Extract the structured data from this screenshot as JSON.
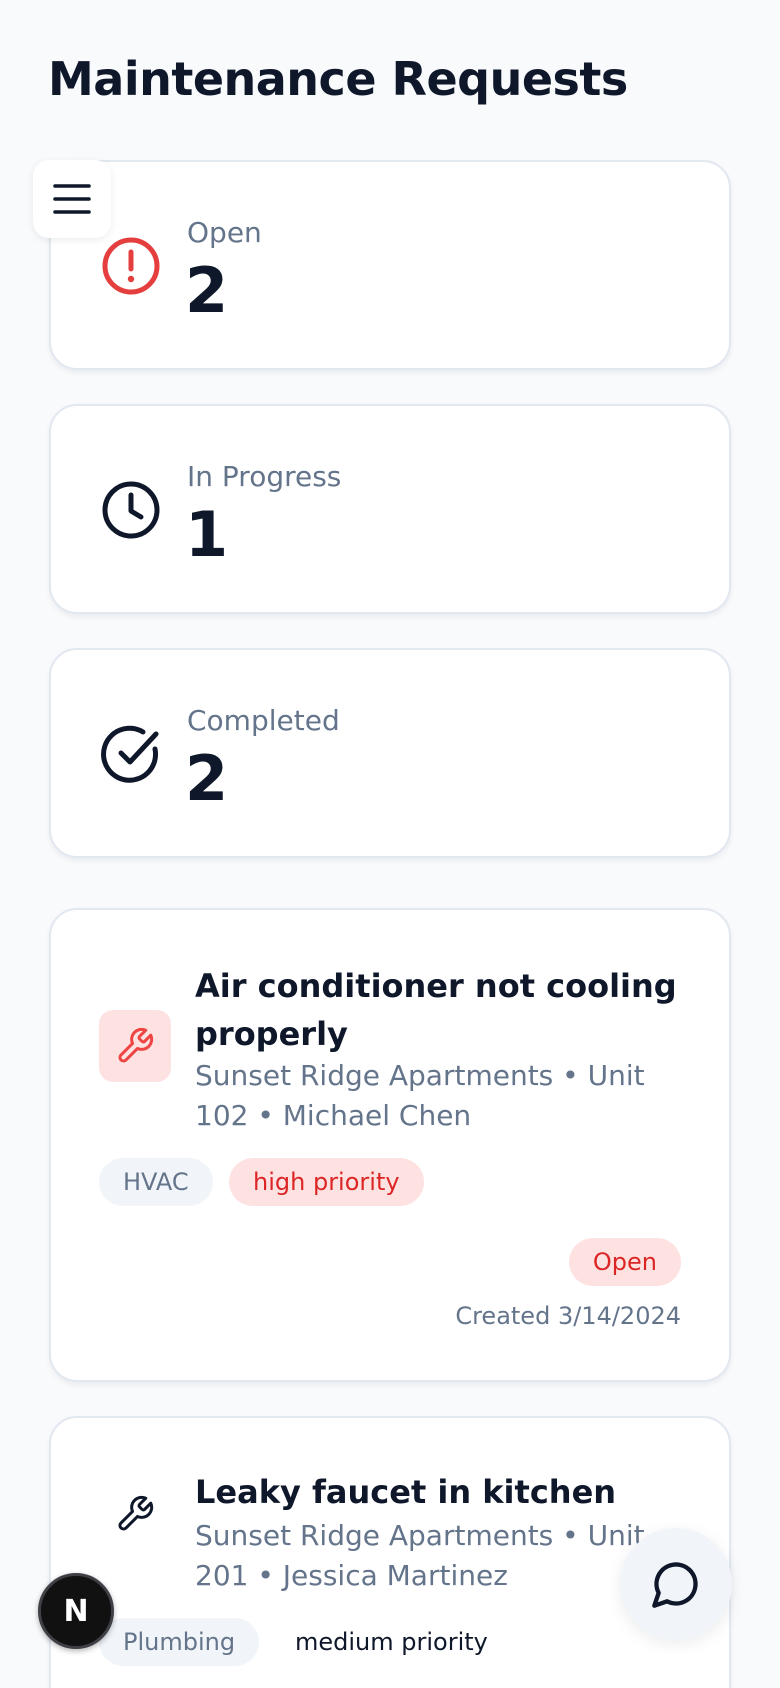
{
  "header": {
    "title": "Maintenance Requests"
  },
  "stats": [
    {
      "label": "Open",
      "value": "2",
      "icon": "alert-circle-icon",
      "color": "#e53e3e"
    },
    {
      "label": "In Progress",
      "value": "1",
      "icon": "clock-icon",
      "color": "#0f172a"
    },
    {
      "label": "Completed",
      "value": "2",
      "icon": "check-circle-icon",
      "color": "#0f172a"
    }
  ],
  "requests": [
    {
      "title": "Air conditioner not cooling properly",
      "meta": "Sunset Ridge Apartments • Unit 102 • Michael Chen",
      "category": "HVAC",
      "priority": "high priority",
      "status": "Open",
      "created": "Created 3/14/2024",
      "icon": "wrench-icon",
      "accent": "#ef4444"
    },
    {
      "title": "Leaky faucet in kitchen",
      "meta": "Sunset Ridge Apartments • Unit 201 • Jessica Martinez",
      "category": "Plumbing",
      "priority": "medium priority",
      "icon": "wrench-icon"
    }
  ],
  "fab": {
    "n_label": "N",
    "chat_icon": "chat-bubble-icon",
    "menu_icon": "hamburger-icon"
  }
}
